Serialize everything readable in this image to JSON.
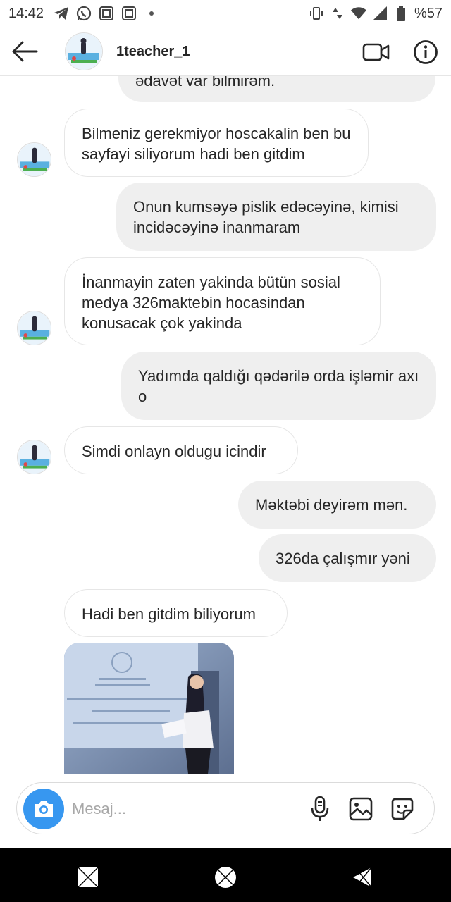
{
  "status_bar": {
    "time": "14:42",
    "battery": "%57",
    "left_icons": [
      "telegram-icon",
      "whatsapp-icon",
      "photo-app-icon",
      "photo-app-icon",
      "dot"
    ],
    "right_icons": [
      "vibrate-icon",
      "data-icon",
      "wifi-icon",
      "signal-icon",
      "battery-icon"
    ]
  },
  "header": {
    "username": "1teacher_1"
  },
  "messages": [
    {
      "side": "out",
      "text": "ədavət var bilmirəm."
    },
    {
      "side": "in",
      "text": "Bilmeniz gerekmiyor hoscakalin ben bu sayfayi siliyorum hadi ben gitdim"
    },
    {
      "side": "out",
      "text": "Onun kumsəyə pislik edəcəyinə, kimisi incidəcəyinə inanmaram"
    },
    {
      "side": "in",
      "text": "İnanmayin zaten yakinda bütün sosial medya 326maktebin hocasindan konusacak çok yakinda"
    },
    {
      "side": "out",
      "text": "Yadımda qaldığı qədərilə orda işləmir axı o"
    },
    {
      "side": "in",
      "text": "Simdi onlayn oldugu icindir"
    },
    {
      "side": "out",
      "text": "Məktəbi deyirəm mən."
    },
    {
      "side": "out",
      "text": "326da çalışmır yəni"
    },
    {
      "side": "in",
      "text": "Hadi ben gitdim biliyorum"
    }
  ],
  "composer": {
    "placeholder": "Mesaj..."
  },
  "colors": {
    "accent": "#3797f0",
    "incoming_bg": "#ffffff",
    "outgoing_bg": "#efefef",
    "navbar": "#000000"
  }
}
